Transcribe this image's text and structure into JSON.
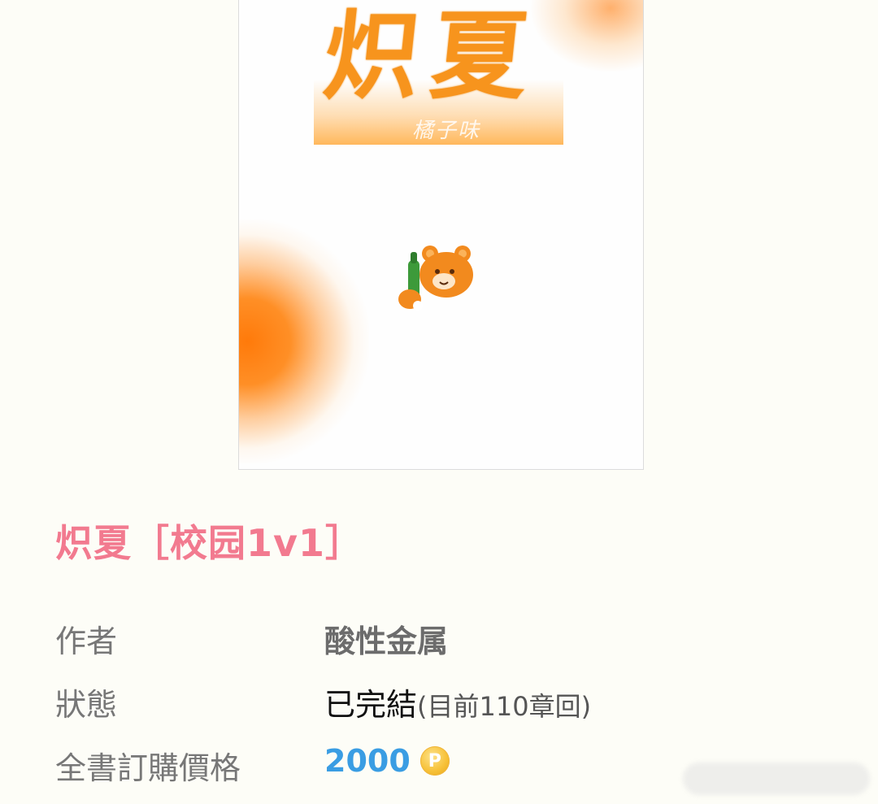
{
  "cover": {
    "title_art": "炽夏",
    "signature": "橘子味",
    "accent_color": "#f7941d"
  },
  "book": {
    "title": "炽夏［校园1v1］",
    "title_color": "#f27a8f"
  },
  "info": {
    "author_label": "作者",
    "author_value": "酸性金属",
    "status_label": "狀態",
    "status_value": "已完結",
    "status_detail": "(目前110章回)",
    "price_label": "全書訂購價格",
    "price_value": "2000",
    "coin_symbol": "P",
    "price_color": "#3a9de3"
  }
}
